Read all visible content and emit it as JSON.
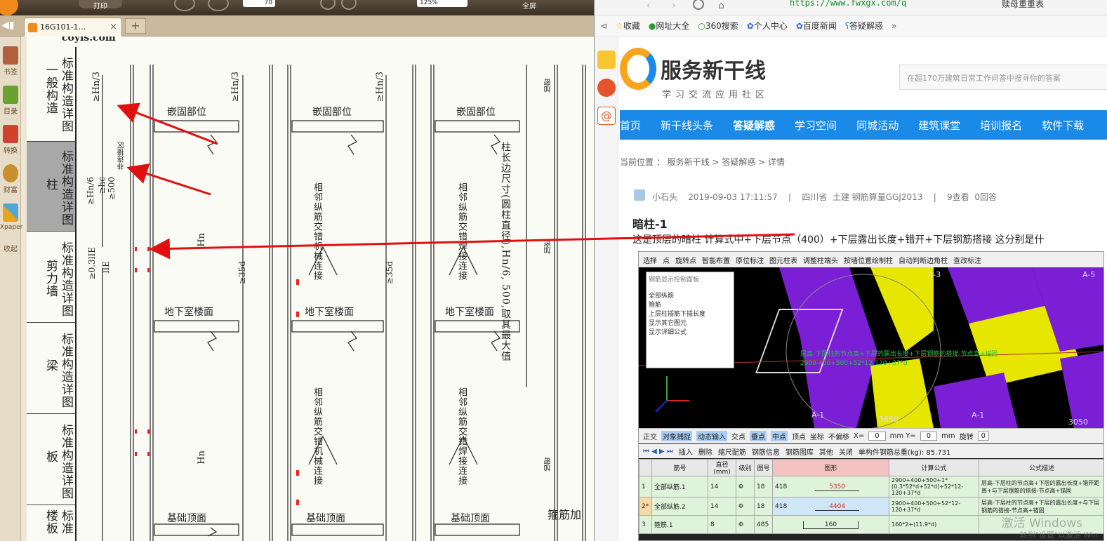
{
  "left_app": {
    "toolbar": {
      "page_value": "70",
      "zoom_value": "125%",
      "print_label": "打印",
      "fullscreen_label": "全屏"
    },
    "tab": {
      "title": "16G101-1…",
      "close": "×",
      "new_tab": "+"
    },
    "sidebar": {
      "items": [
        "书签",
        "目录",
        "转换",
        "财富",
        "Xpaper",
        "收起"
      ]
    },
    "page": {
      "watermark_url": "coyis.com",
      "section_labels": [
        "一般构造",
        "标准构造详图",
        "柱",
        "标准构造详图",
        "剪力墙",
        "标准构造详图",
        "梁",
        "标准构造详图",
        "板",
        "标准构造详图",
        "楼板"
      ],
      "labels": {
        "embed": "嵌固部位",
        "basement_floor": "地下室楼面",
        "foundation_top": "基础顶面",
        "adjacent_mech": "相邻纵筋交错机械连接",
        "adjacent_weld": "相邻纵筋交错焊接连接",
        "col_max": "柱长边尺寸(圆柱直径),Hn/6, 500,取其最大值",
        "non_connect": "非连接区",
        "stirrup": "箍筋加",
        "dense": "加密",
        "hn3": "≥Hn/3",
        "hn6": "≥Hn/6",
        "hc": "≥hc",
        "v500": "≥500",
        "v35d": "≥35d",
        "le": "≥0.3lIE",
        "lle": "lIE",
        "hn": "Hn"
      }
    }
  },
  "browser": {
    "url": "https://www.fwxgx.com/q",
    "search_box": "赎母重重表",
    "bookmarks": [
      "收藏",
      "网址大全",
      "360搜索",
      "个人中心",
      "百度新闻",
      "答疑解惑"
    ],
    "site": {
      "logo_title": "服务新干线",
      "logo_subtitle": "学习交流应用社区",
      "search_placeholder": "在超170万建筑日常工作问答中搜寻你的答案",
      "nav": [
        "首页",
        "新干线头条",
        "答疑解惑",
        "学习空间",
        "同城活动",
        "建筑课堂",
        "培训报名",
        "软件下载"
      ],
      "breadcrumb": "当前位置 ： 服务新干线 > 答疑解惑 > 详情",
      "author": "小石头",
      "date": "2019-09-03 17:11:57",
      "separator": "|",
      "region": "四川省",
      "category": "土建 钢筋算量GGJ2013",
      "views": "9查看",
      "answers": "0回答",
      "question_title": "暗柱-1",
      "question_body": "这是顶层的暗柱 计算式中+下层节点（400）+下层露出长度+错开+下层钢筋搭接 这分别是什",
      "screenshot": {
        "toolbar1": [
          "选择",
          "点",
          "旋转点",
          "智能布置",
          "原位标注",
          "图元柱表",
          "调整柱端头",
          "按墙位置绘制柱",
          "自动判断边角柱",
          "查改标注"
        ],
        "panel_title": "钢筋显示控制面板",
        "panel_items": [
          "全部纵筋",
          "箍筋",
          "上层柱插筋下插长度",
          "显示其它图元",
          "显示详细公式"
        ],
        "axis_labels": [
          "A-3",
          "A-5",
          "A-1",
          "A-1",
          "3650",
          "3050"
        ],
        "formula_overlay": "层高-下层柱的节点高+下层的露出长度+下层钢筋的搭接-节点高+锚固",
        "formula_overlay2": "2900-400+500+52*12-120+37*d",
        "toolbar2": [
          "正交",
          "对象捕捉",
          "动态输入",
          "交点",
          "垂点",
          "中点",
          "顶点",
          "坐标",
          "不偏移",
          "X=",
          "0",
          "mm Y=",
          "0",
          "mm",
          "旋转",
          "0"
        ],
        "toolbar3": [
          "插入",
          "删除",
          "缩尺配筋",
          "钢筋信息",
          "钢筋图库",
          "其他",
          "关闭",
          "单构件钢筋总重(kg): 85.731"
        ],
        "table_headers": [
          "",
          "筋号",
          "直径(mm)",
          "级别",
          "图号",
          "图形",
          "计算公式",
          "公式描述"
        ],
        "rows": [
          {
            "no": "1",
            "name": "全部纵筋.1",
            "dia": "14",
            "grade": "Φ",
            "fig": "18",
            "shape_l": "418",
            "shape_v": "5350",
            "formula": "2900+400+500+1*(0.3*52*d+52*d)+52*12-120+37*d",
            "desc": "层高-下层柱的节点高+下层的露出长度+错开距离+与下层钢筋的搭接-节点高+锚固"
          },
          {
            "no": "2*",
            "name": "全部纵筋.2",
            "dia": "14",
            "grade": "Φ",
            "fig": "18",
            "shape_l": "418",
            "shape_v": "4404",
            "formula": "2900+400+500+52*12-120+37*d",
            "desc": "层高-下层柱的节点高+下层的露出长度+与下层钢筋的搭接-节点高+锚固"
          },
          {
            "no": "3",
            "name": "箍筋.1",
            "dia": "8",
            "grade": "Φ",
            "fig": "485",
            "shape_l": "",
            "shape_v": "160",
            "formula": "160*2+(11.9*d)",
            "desc": ""
          }
        ],
        "watermark": "激活 Windows",
        "watermark_sub": "转到\"设置\"以激活 Win"
      }
    }
  },
  "colors": {
    "nav_blue": "#1a8ae8",
    "arrow_red": "#e01010",
    "purple": "#7a1fd6",
    "yellow": "#e6e600",
    "table_green": "#dff3da"
  }
}
